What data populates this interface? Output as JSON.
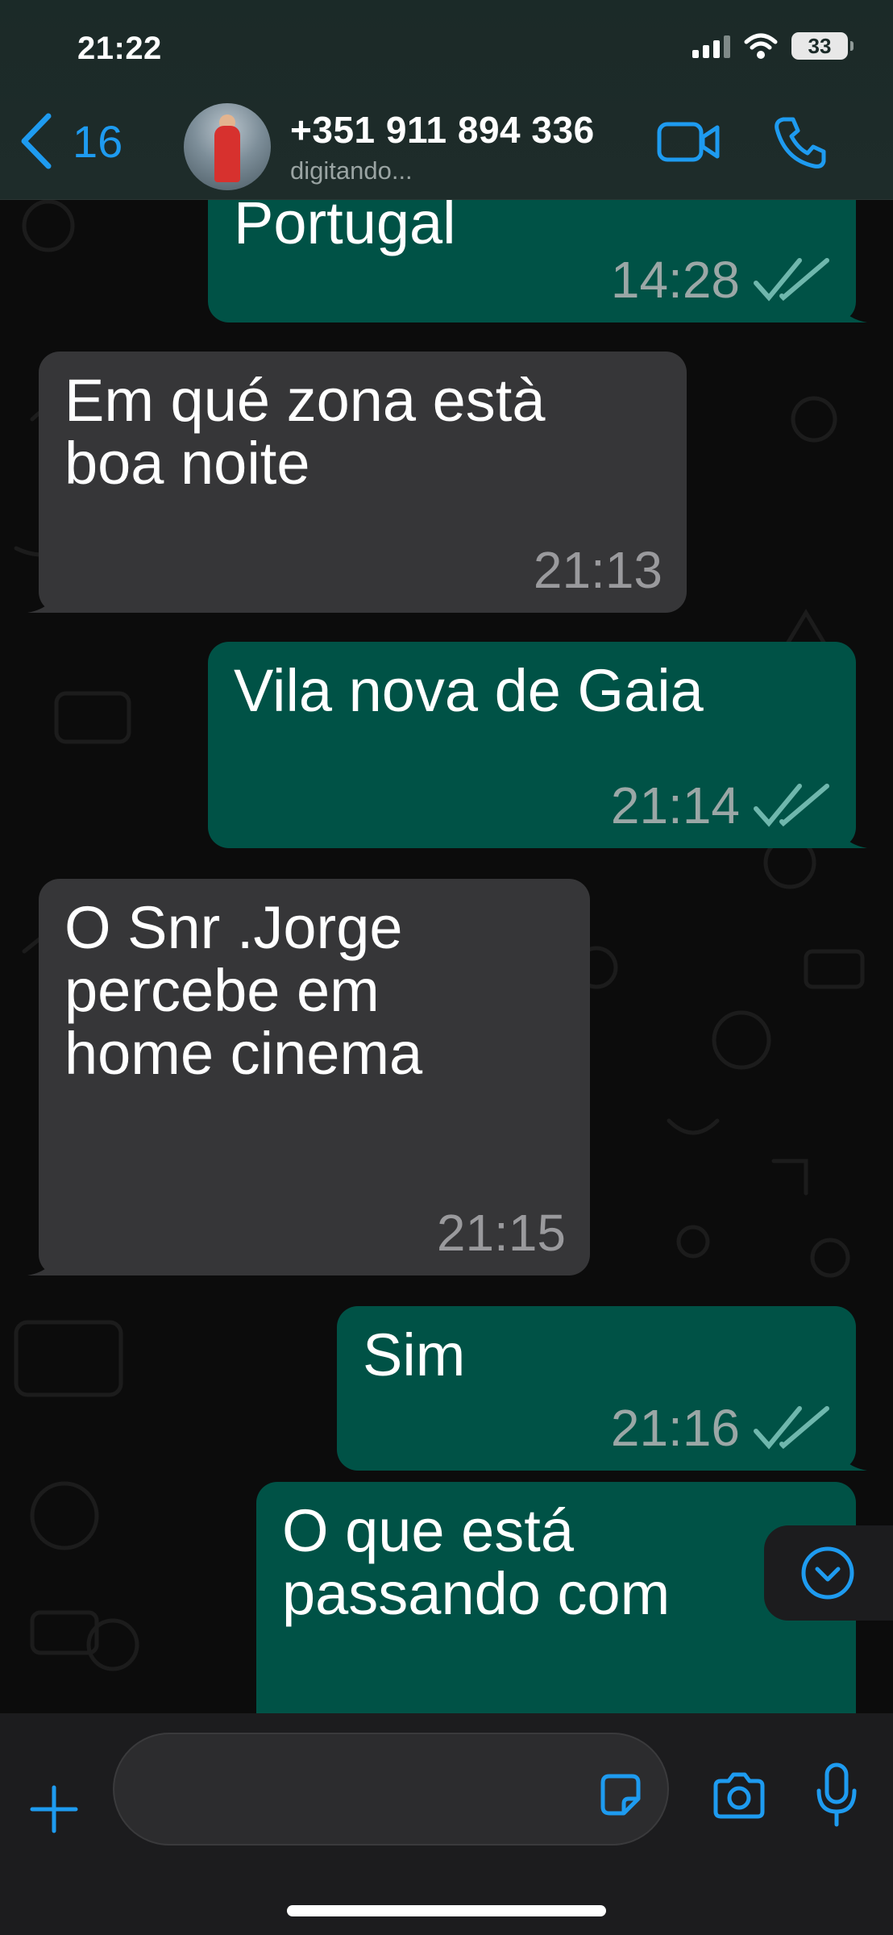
{
  "status_bar": {
    "time": "21:22",
    "battery": "33"
  },
  "header": {
    "back_count": "16",
    "contact_name": "+351 911 894 336",
    "contact_status": "digitando..."
  },
  "messages": [
    {
      "direction": "out",
      "text": "Portugal",
      "time": "14:28",
      "read": true
    },
    {
      "direction": "in",
      "text": "Em qué zona està\nboa noite",
      "time": "21:13"
    },
    {
      "direction": "out",
      "text": "Vila nova de Gaia",
      "time": "21:14",
      "read": true
    },
    {
      "direction": "in",
      "text": "O  Snr .Jorge\npercebe em\nhome cinema",
      "time": "21:15"
    },
    {
      "direction": "out",
      "text": "Sim",
      "time": "21:16",
      "read": true
    },
    {
      "direction": "out",
      "text": "O que está\npassando com",
      "time": ""
    }
  ],
  "composer": {
    "placeholder": ""
  },
  "colors": {
    "accent": "#1e9bf0",
    "incoming_bubble": "#363638",
    "outgoing_bubble": "#005246",
    "read_ticks": "#6fb7ad"
  },
  "icons": [
    "chevron-left-icon",
    "video-call-icon",
    "phone-icon",
    "double-check-icon",
    "chevron-down-icon",
    "plus-icon",
    "sticker-icon",
    "camera-icon",
    "mic-icon"
  ]
}
